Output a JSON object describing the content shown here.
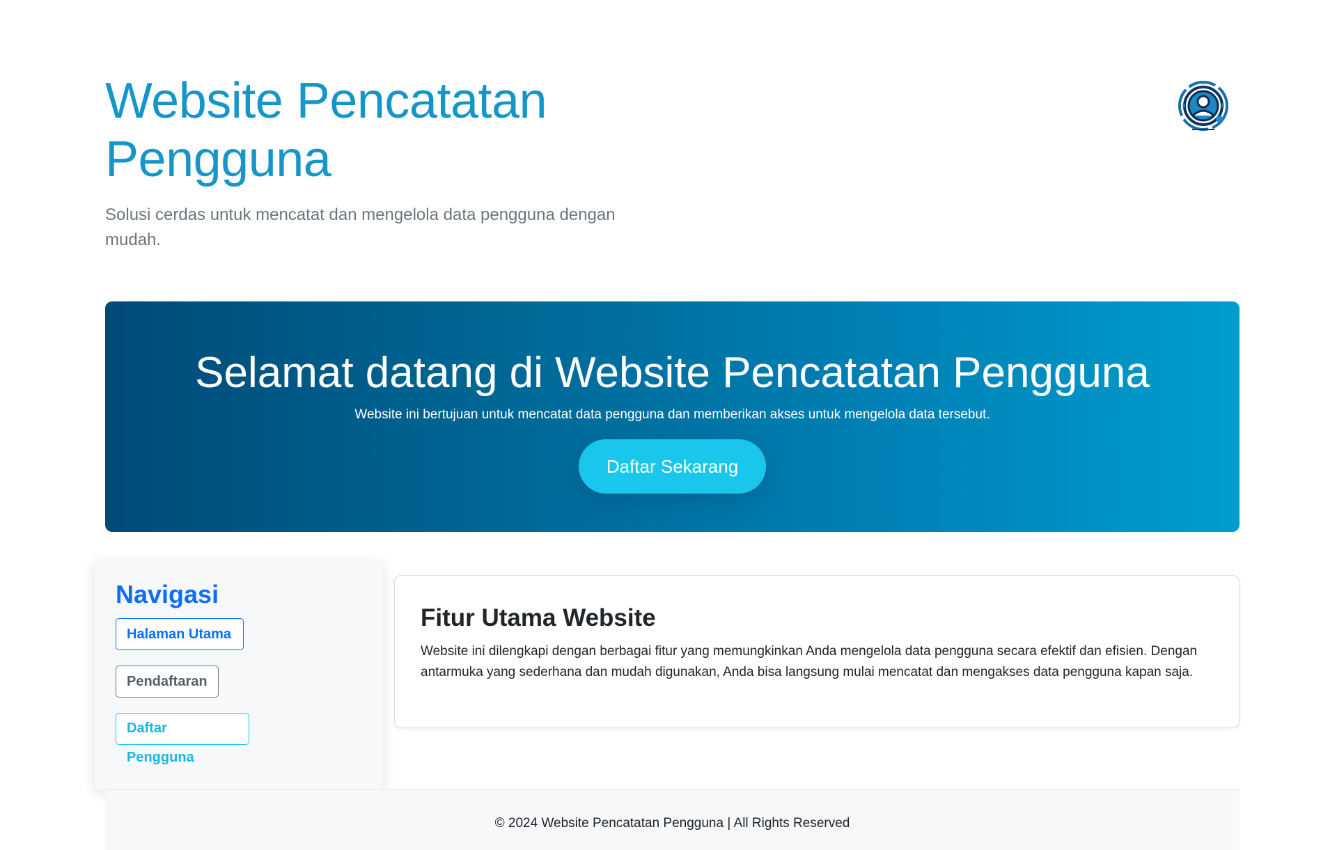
{
  "header": {
    "title": "Website Pencatatan Pengguna",
    "subtitle": "Solusi cerdas untuk mencatat dan mengelola data pengguna dengan mudah.",
    "logo_icon": "user-circle-logo-icon"
  },
  "hero": {
    "title": "Selamat datang di Website Pencatatan Pengguna",
    "text": "Website ini bertujuan untuk mencatat data pengguna dan memberikan akses untuk mengelola data tersebut.",
    "button_label": "Daftar Sekarang",
    "gradient_start": "#004a78",
    "gradient_end": "#009dcf",
    "button_color": "#1ac6ec"
  },
  "navigation": {
    "title": "Navigasi",
    "items": [
      {
        "label": "Halaman Utama",
        "style": "primary"
      },
      {
        "label": "Pendaftaran",
        "style": "secondary"
      },
      {
        "label": "Daftar Pengguna",
        "style": "info"
      }
    ]
  },
  "features": {
    "title": "Fitur Utama Website",
    "text": "Website ini dilengkapi dengan berbagai fitur yang memungkinkan Anda mengelola data pengguna secara efektif dan efisien. Dengan antarmuka yang sederhana dan mudah digunakan, Anda bisa langsung mulai mencatat dan mengakses data pengguna kapan saja."
  },
  "footer": {
    "text": "© 2024 Website Pencatatan Pengguna | All Rights Reserved"
  },
  "colors": {
    "primary": "#0d6efd",
    "title_blue": "#1596c9",
    "muted": "#6c757d",
    "info": "#1ac6ec"
  }
}
